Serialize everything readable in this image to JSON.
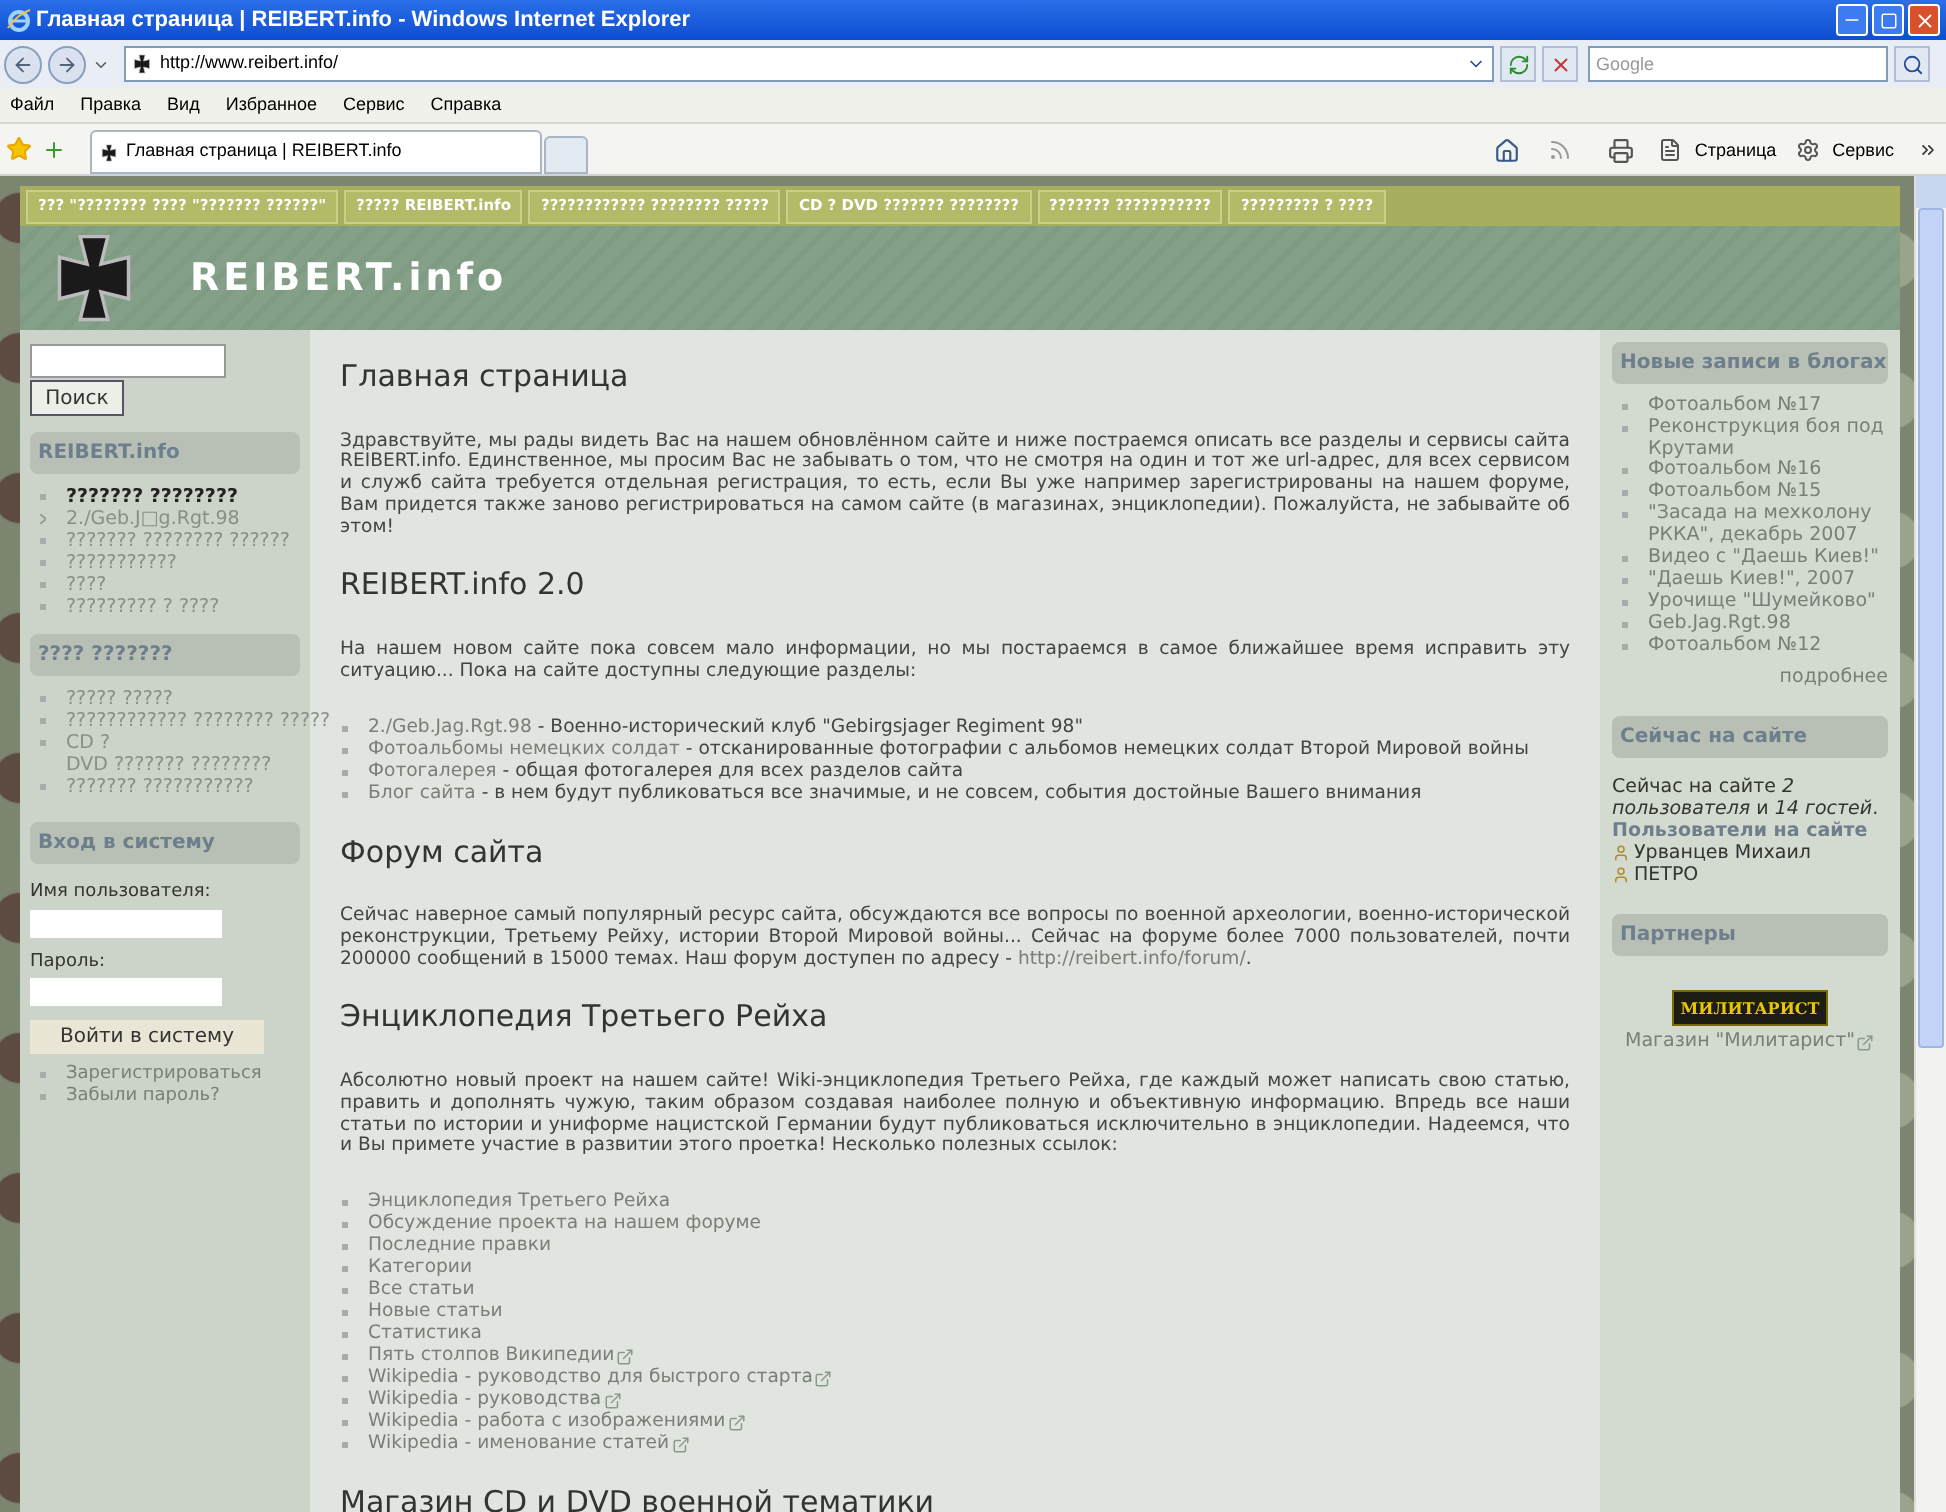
{
  "browser": {
    "title": "Главная страница | REIBERT.info - Windows Internet Explorer",
    "address": "http://www.reibert.info/",
    "search_placeholder": "Google",
    "menu": [
      "Файл",
      "Правка",
      "Вид",
      "Избранное",
      "Сервис",
      "Справка"
    ],
    "tabs": [
      {
        "label": "Главная страница | REIBERT.info",
        "selected": true
      }
    ],
    "toolbar": [
      "Страница",
      "Сервис"
    ]
  },
  "site": {
    "nav": [
      "??? \"???????? ???? \"??????? ??????\"",
      "????? REIBERT.info",
      "???????????? ???????? ?????",
      "CD ? DVD ??????? ????????",
      "??????? ???????????",
      "????????? ? ????"
    ],
    "logo_text": "REIBERT.info"
  },
  "left": {
    "search_button": "Поиск",
    "menus": [
      {
        "title": "REIBERT.info",
        "items": [
          {
            "label": "??????? ????????",
            "selected": true,
            "kind": "leaf"
          },
          {
            "label": "2./Geb.J□g.Rgt.98",
            "selected": false,
            "kind": "expandable"
          },
          {
            "label": "??????? ???????? ??????",
            "selected": false,
            "kind": "leaf"
          },
          {
            "label": "???????????",
            "selected": false,
            "kind": "leaf"
          },
          {
            "label": "????",
            "selected": false,
            "kind": "leaf"
          },
          {
            "label": "????????? ? ????",
            "selected": false,
            "kind": "leaf"
          }
        ]
      },
      {
        "title": "???? ???????",
        "items": [
          {
            "label": "????? ?????",
            "selected": false,
            "kind": "leaf"
          },
          {
            "label": "???????????? ???????? ?????",
            "selected": false,
            "kind": "leaf"
          },
          {
            "label": "CD ?\nDVD ??????? ????????",
            "selected": false,
            "kind": "leaf"
          },
          {
            "label": "??????? ???????????",
            "selected": false,
            "kind": "leaf"
          }
        ]
      }
    ],
    "login": {
      "title": "Вход в систему",
      "username_label": "Имя пользователя:",
      "password_label": "Пароль:",
      "button": "Войти в систему",
      "links": [
        "Зарегистрироваться",
        "Забыли пароль?"
      ]
    }
  },
  "main": {
    "sections": [
      {
        "heading": "Главная страница",
        "blocks": [
          {
            "kind": "paragraph",
            "parts": [
              {
                "text": "Здравствуйте, мы рады видеть Вас на нашем обновлённом сайте и ниже постраемся описать все разделы и сервисы сайта REIBERT.info. Единственное, мы просим Вас не забывать о том, что не смотря на один и тот же url-адрес, для всех сервисом и служб сайта требуется отдельная регистрация, то есть, если Вы уже например зарегистрированы на нашем форуме, Вам придется также заново регистрироваться на самом сайте (в магазинах, энциклопедии). Пожалуйста, не забывайте об этом!",
                "link": false
              }
            ]
          }
        ]
      },
      {
        "heading": "REIBERT.info 2.0",
        "blocks": [
          {
            "kind": "paragraph",
            "parts": [
              {
                "text": "На нашем новом сайте пока совсем мало информации, но мы постараемся в самое ближайшее время исправить эту ситуацию... Пока на сайте доступны следующие разделы:",
                "link": false
              }
            ]
          },
          {
            "kind": "described_list",
            "items": [
              {
                "link": "2./Geb.Jag.Rgt.98",
                "text": "- Военно-исторический клуб \"Gebirgsjager Regiment 98\""
              },
              {
                "link": "Фотоальбомы немецких солдат",
                "text": "- отсканированные фотографии с альбомов немецких солдат Второй Мировой войны"
              },
              {
                "link": "Фотогалерея",
                "text": "- общая фотогалерея для всех разделов сайта"
              },
              {
                "link": "Блог сайта",
                "text": "- в нем будут публиковаться все значимые, и не совсем, события достойные Вашего внимания"
              }
            ]
          }
        ]
      },
      {
        "heading": "Форум сайта",
        "blocks": [
          {
            "kind": "paragraph",
            "parts": [
              {
                "text": "Сейчас наверное самый популярный ресурс сайта, обсуждаются все вопросы по военной археологии, военно-исторической реконструкции, Третьему Рейху, истории Второй Мировой войны... Сейчас на форуме более 7000 пользователей, почти 200000 сообщений в 15000 темах. Наш форум доступен по адресу - ",
                "link": false
              },
              {
                "text": "http://reibert.info/forum/",
                "link": true
              },
              {
                "text": ".",
                "link": false
              }
            ]
          }
        ]
      },
      {
        "heading": "Энциклопедия Третьего Рейха",
        "blocks": [
          {
            "kind": "paragraph",
            "parts": [
              {
                "text": "Абсолютно новый проект на нашем сайте! Wiki-энциклопедия Третьего Рейха, где каждый может написать свою статью, править и дополнять чужую, таким образом создавая наиболее полную и объективную информацию. Впредь все наши статьи по истории и униформе нацистской Германии будут публиковаться исключительно в энциклопедии. Надеемся, что и Вы примете участие в развитии этого проетка! Несколько полезных ссылок:",
                "link": false
              }
            ]
          },
          {
            "kind": "link_list",
            "items": [
              {
                "text": "Энциклопедия Третьего Рейха",
                "external": false
              },
              {
                "text": "Обсуждение проекта на нашем форуме",
                "external": false
              },
              {
                "text": "Последние правки",
                "external": false
              },
              {
                "text": "Категории",
                "external": false
              },
              {
                "text": "Все статьи",
                "external": false
              },
              {
                "text": "Новые статьи",
                "external": false
              },
              {
                "text": "Статистика",
                "external": false
              },
              {
                "text": "Пять столпов Википедии",
                "external": true
              },
              {
                "text": "Wikipedia - руководство для быстрого старта",
                "external": true
              },
              {
                "text": "Wikipedia - руководства",
                "external": true
              },
              {
                "text": "Wikipedia - работа с изображениями",
                "external": true
              },
              {
                "text": "Wikipedia - именование статей",
                "external": true
              }
            ]
          }
        ]
      },
      {
        "heading": "Магазин CD и DVD военной тематики"
      }
    ]
  },
  "right": {
    "blogs": {
      "title": "Новые записи в блогах",
      "items": [
        "Фотоальбом №17",
        "Реконструкция боя под Крутами",
        "Фотоальбом №16",
        "Фотоальбом №15",
        "\"Засада на мехколону РККА\", декабрь 2007",
        "Видео с \"Даешь Киев!\"",
        "\"Даешь Киев!\", 2007",
        "Урочище \"Шумейково\"",
        "Geb.Jag.Rgt.98",
        "Фотоальбом №12"
      ],
      "more": "подробнее"
    },
    "online": {
      "title": "Сейчас на сайте",
      "summary": "Сейчас на сайте *2 пользователя* и *14 гостей*.",
      "users_title": "Пользователи на сайте",
      "users": [
        "Урванцев Михаил",
        "ПЕТРО"
      ]
    },
    "partners": {
      "title": "Партнеры",
      "logo_text": "МИЛИТАРИСТ",
      "caption": "Магазин \"Милитарист\""
    }
  }
}
